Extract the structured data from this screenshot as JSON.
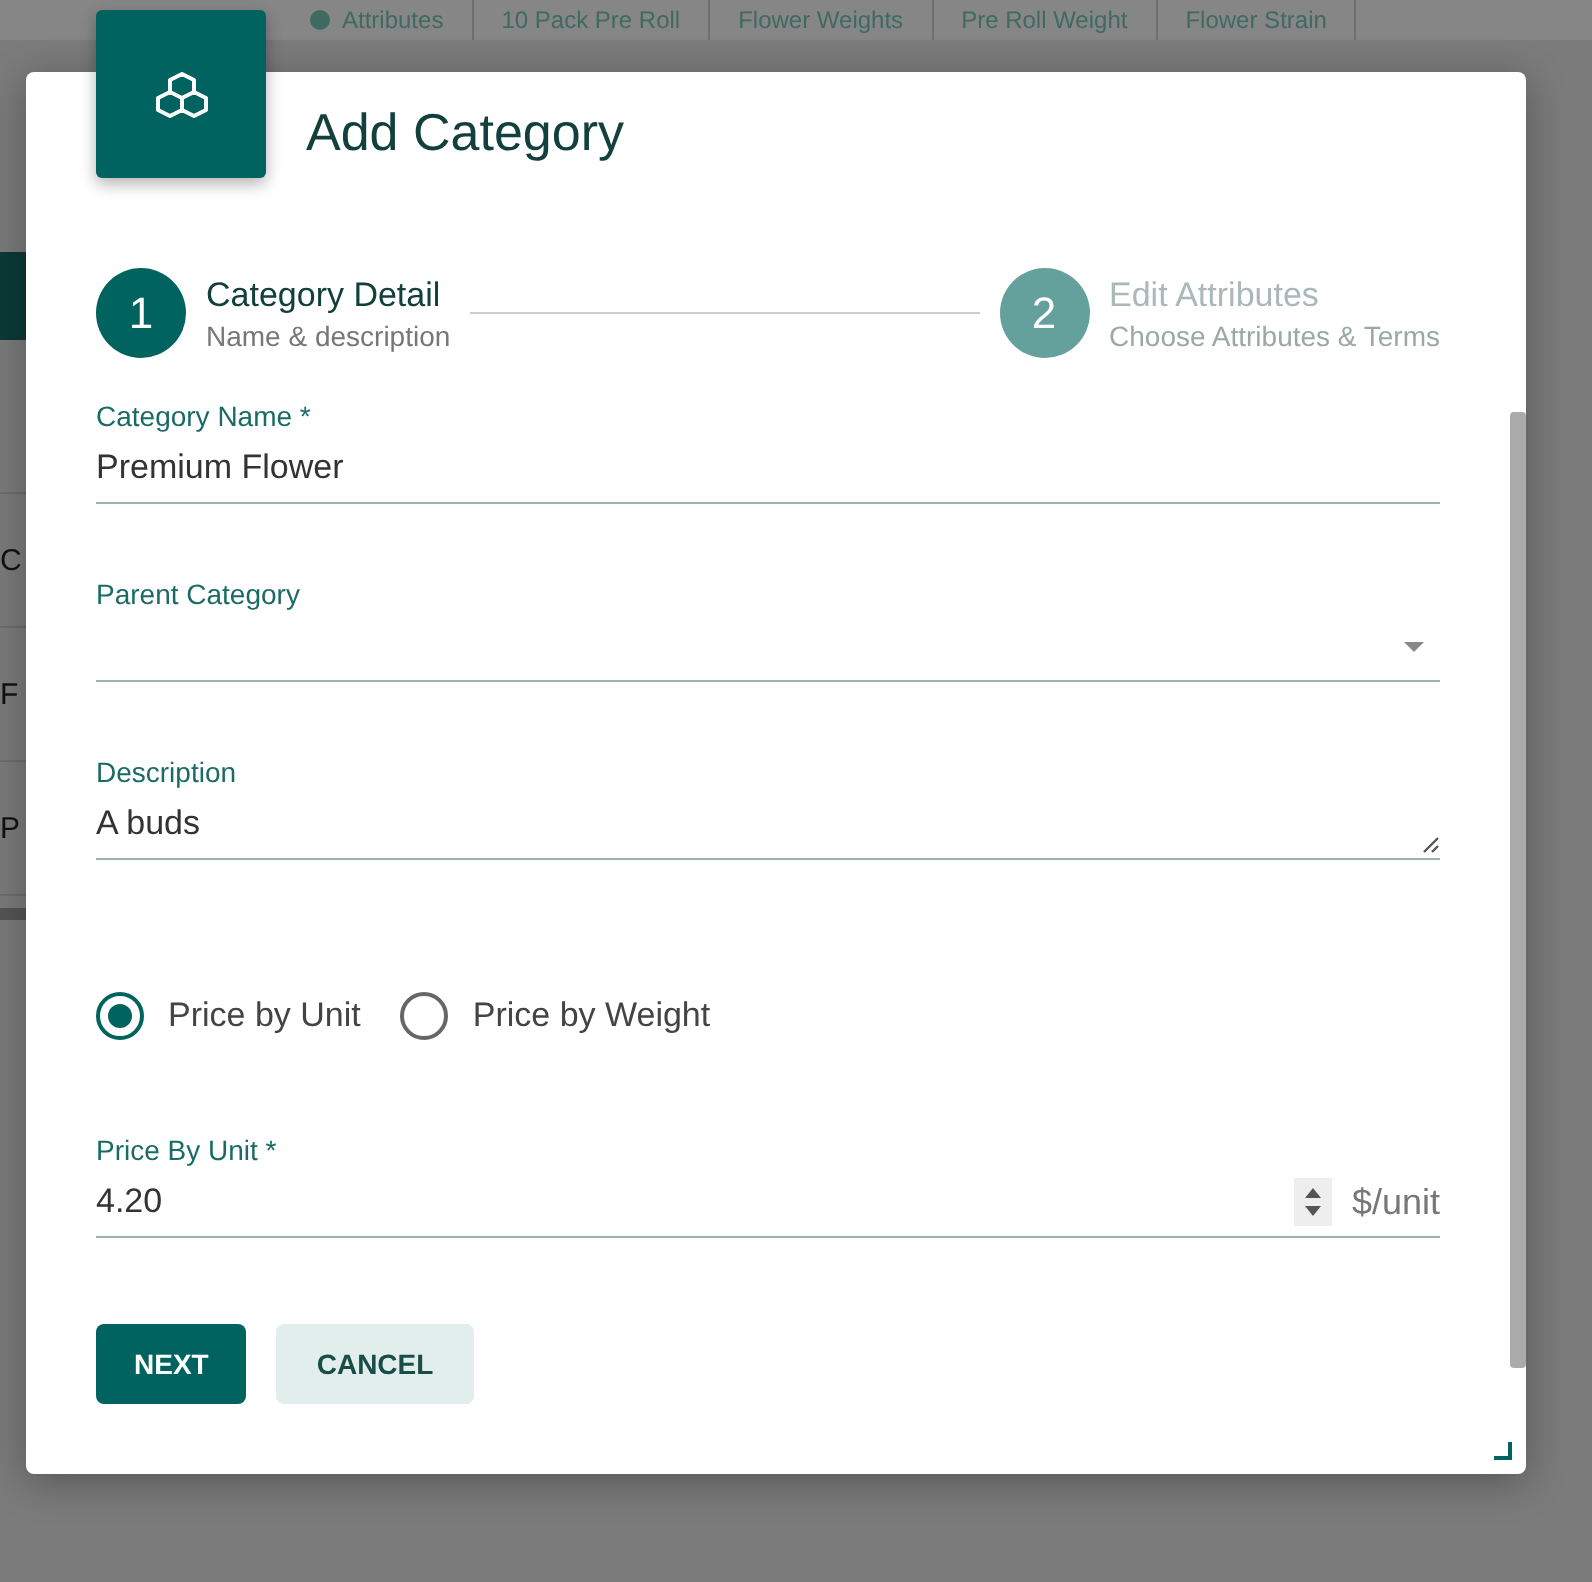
{
  "background": {
    "tabs": [
      "Attributes",
      "10 Pack Pre Roll",
      "Flower Weights",
      "Pre Roll Weight",
      "Flower Strain"
    ],
    "rows": [
      "C",
      "F",
      "P"
    ]
  },
  "dialog": {
    "title": "Add Category",
    "steps": [
      {
        "number": "1",
        "title": "Category Detail",
        "subtitle": "Name & description",
        "selected": true
      },
      {
        "number": "2",
        "title": "Edit Attributes",
        "subtitle": "Choose Attributes & Terms",
        "selected": false
      }
    ],
    "fields": [
      {
        "kind": "text",
        "label": "Category Name *",
        "value": "Premium Flower"
      },
      {
        "kind": "select",
        "label": "Parent Category"
      },
      {
        "kind": "textarea",
        "label": "Description",
        "value": "A buds"
      }
    ],
    "pricing": [
      {
        "label": "Price by Unit",
        "selected": true
      },
      {
        "label": "Price by Weight",
        "selected": false
      }
    ],
    "price": {
      "label": "Price By Unit *",
      "value": "4.20",
      "suffix": "$/unit"
    },
    "buttons": [
      {
        "kind": "primary",
        "label": "NEXT"
      },
      {
        "kind": "secondary",
        "label": "CANCEL"
      }
    ]
  }
}
